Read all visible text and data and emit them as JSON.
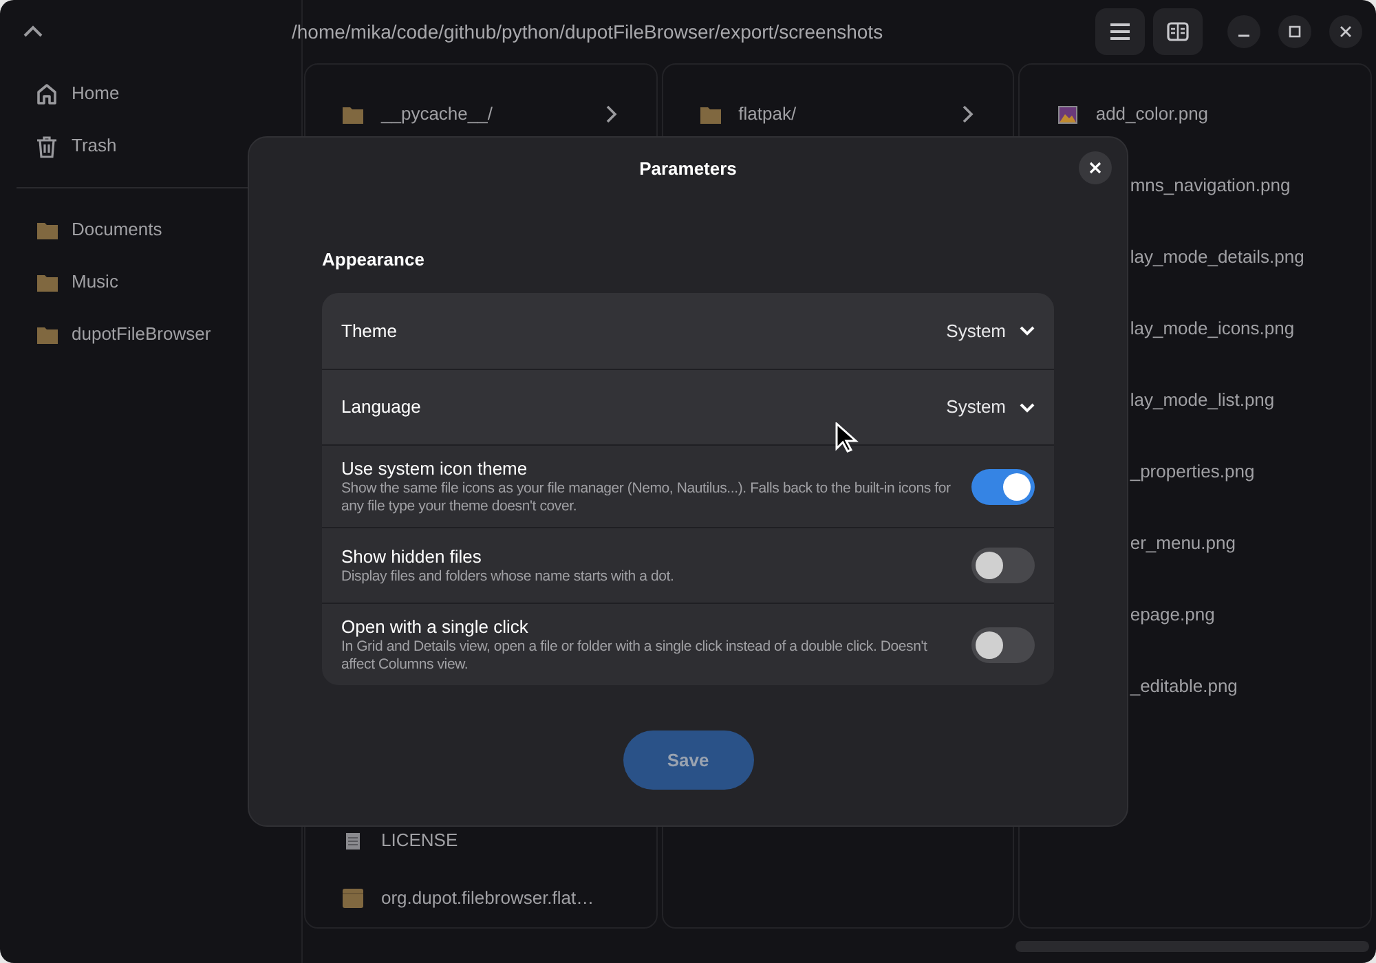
{
  "header": {
    "path": "/home/mika/code/github/python/dupotFileBrowser/export/screenshots"
  },
  "sidebar": {
    "places": [
      {
        "label": "Home",
        "kind": "home"
      },
      {
        "label": "Trash",
        "kind": "trash"
      }
    ],
    "bookmarks": [
      {
        "label": "Documents",
        "kind": "folder"
      },
      {
        "label": "Music",
        "kind": "folder"
      },
      {
        "label": "dupotFileBrowser",
        "kind": "folder"
      }
    ]
  },
  "columns": [
    {
      "top": [
        {
          "name": "__pycache__/",
          "kind": "folder",
          "arrow": true
        }
      ],
      "bottom": [
        {
          "name": "LICENSE",
          "kind": "document"
        },
        {
          "name": "org.dupot.filebrowser.flat…",
          "kind": "package"
        }
      ]
    },
    {
      "top": [
        {
          "name": "flatpak/",
          "kind": "folder",
          "arrow": true
        }
      ]
    },
    {
      "top": [
        {
          "name": "add_color.png",
          "kind": "image"
        },
        {
          "name": "mns_navigation.png",
          "cut": true
        },
        {
          "name": "lay_mode_details.png",
          "cut": true
        },
        {
          "name": "lay_mode_icons.png",
          "cut": true
        },
        {
          "name": "lay_mode_list.png",
          "cut": true
        },
        {
          "name": "_properties.png",
          "cut": true
        },
        {
          "name": "er_menu.png",
          "cut": true
        },
        {
          "name": "epage.png",
          "cut": true
        },
        {
          "name": "_editable.png",
          "cut": true
        }
      ]
    }
  ],
  "dialog": {
    "title": "Parameters",
    "section": "Appearance",
    "rows": [
      {
        "kind": "dropdown",
        "label": "Theme",
        "value": "System"
      },
      {
        "kind": "dropdown",
        "label": "Language",
        "value": "System"
      },
      {
        "kind": "switch",
        "label": "Use system icon theme",
        "description": "Show the same file icons as your file manager (Nemo, Nautilus...). Falls back to the built-in icons for any file type your theme doesn't cover.",
        "on": true
      },
      {
        "kind": "switch",
        "label": "Show hidden files",
        "description": "Display files and folders whose name starts with a dot.",
        "on": false
      },
      {
        "kind": "switch",
        "label": "Open with a single click",
        "description": "In Grid and Details view, open a file or folder with a single click instead of a double click. Doesn't affect Columns view.",
        "on": false
      }
    ],
    "save": "Save"
  }
}
